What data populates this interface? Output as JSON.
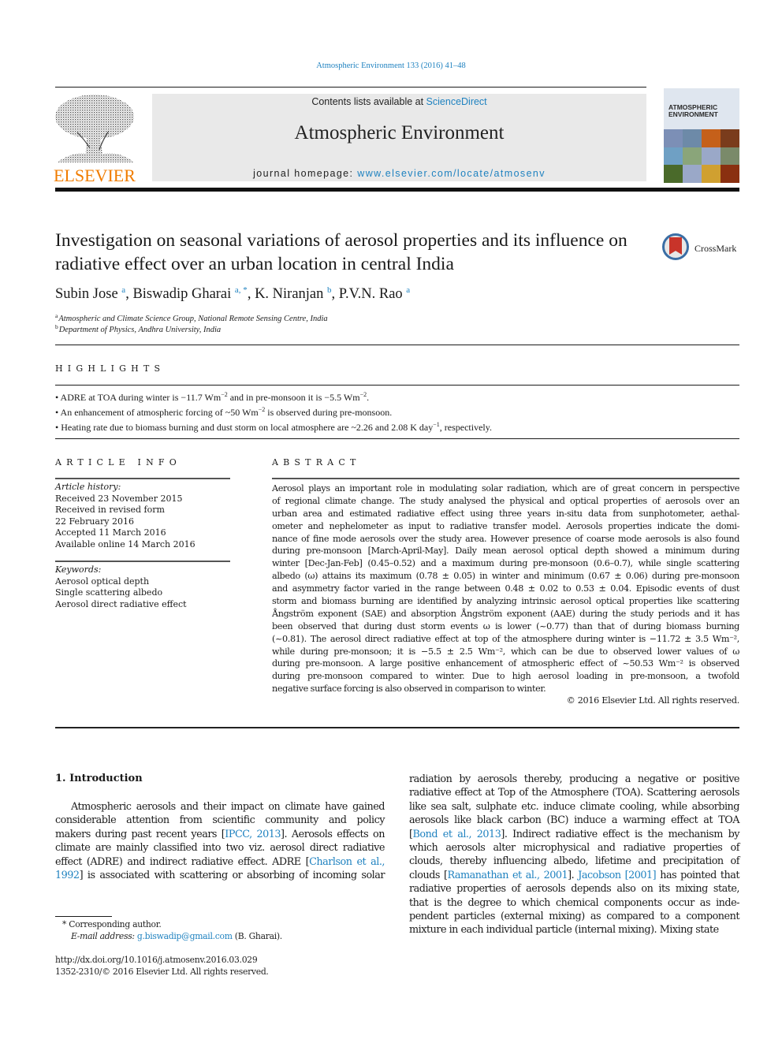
{
  "header": {
    "journal_ref": "Atmospheric Environment 133 (2016) 41–48",
    "contents_prefix": "Contents lists available at ",
    "contents_link": "ScienceDirect",
    "journal_name": "Atmospheric Environment",
    "homepage_prefix": "journal homepage: ",
    "homepage_link": "www.elsevier.com/locate/atmosenv",
    "publisher_logo": "ELSEVIER",
    "cover_title_line1": "ATMOSPHERIC",
    "cover_title_line2": "ENVIRONMENT"
  },
  "colors": {
    "link": "#1f82c0",
    "elsevier_orange": "#f07c00",
    "banner_bg": "#e9e9e9"
  },
  "article": {
    "title": "Investigation on seasonal variations of aerosol properties and its influence on radiative effect over an urban location in central India",
    "crossmark_label": "CrossMark",
    "authors": [
      {
        "name": "Subin Jose",
        "sup": "a",
        "sep": ", "
      },
      {
        "name": "Biswadip Gharai",
        "sup": "a, *",
        "sep": ", "
      },
      {
        "name": "K. Niranjan",
        "sup": "b",
        "sep": ", "
      },
      {
        "name": "P.V.N. Rao",
        "sup": "a",
        "sep": ""
      }
    ],
    "affiliations": [
      {
        "key": "a",
        "text": "Atmospheric and Climate Science Group, National Remote Sensing Centre, India"
      },
      {
        "key": "b",
        "text": "Department of Physics, Andhra University, India"
      }
    ]
  },
  "highlights": {
    "heading": "HIGHLIGHTS",
    "items": [
      {
        "parts": [
          "• ADRE at TOA during winter is −11.7 Wm",
          "−2",
          " and in pre-monsoon it is −5.5 Wm",
          "−2",
          "."
        ]
      },
      {
        "parts": [
          "• An enhancement of atmospheric forcing of ~50 Wm",
          "−2",
          " is observed during pre-monsoon."
        ]
      },
      {
        "parts": [
          "• Heating rate due to biomass burning and dust storm on local atmosphere are ~2.26 and 2.08 K day",
          "−1",
          ", respectively."
        ]
      }
    ]
  },
  "article_info": {
    "heading": "ARTICLE INFO",
    "history_label": "Article history:",
    "history": [
      "Received 23 November 2015",
      "Received in revised form",
      "22 February 2016",
      "Accepted 11 March 2016",
      "Available online 14 March 2016"
    ],
    "keywords_label": "Keywords:",
    "keywords": [
      "Aerosol optical depth",
      "Single scattering albedo",
      "Aerosol direct radiative effect"
    ]
  },
  "abstract": {
    "heading": "ABSTRACT",
    "lines": [
      "Aerosol plays an important role in modulating solar radiation, which are of great concern in perspective",
      "of regional climate change. The study analysed the physical and optical properties of aerosols over an",
      "urban area and estimated radiative effect using three years in-situ data from sunphotometer, aethal-",
      "ometer and nephelometer as input to radiative transfer model. Aerosols properties indicate the domi-",
      "nance of fine mode aerosols over the study area. However presence of coarse mode aerosols is also found",
      "during pre-monsoon [March-April-May]. Daily mean aerosol optical depth showed a minimum during",
      "winter [Dec-Jan-Feb] (0.45–0.52) and a maximum during pre-monsoon (0.6–0.7), while single scattering",
      "albedo (ω) attains its maximum (0.78 ± 0.05) in winter and minimum (0.67 ± 0.06) during pre-monsoon",
      "and asymmetry factor varied in the range between 0.48 ± 0.02 to 0.53 ± 0.04. Episodic events of dust",
      "storm and biomass burning are identified by analyzing intrinsic aerosol optical properties like scattering",
      "Ångström exponent (SAE) and absorption Ångström exponent (AAE) during the study periods and it has",
      "been observed that during dust storm events ω is lower (~0.77) than that of during biomass burning",
      "(~0.81). The aerosol direct radiative effect at top of the atmosphere during winter is −11.72 ± 3.5 Wm⁻²,",
      "while during pre-monsoon; it is −5.5 ± 2.5 Wm⁻², which can be due to observed lower values of ω",
      "during pre-monsoon. A large positive enhancement of atmospheric effect of ~50.53 Wm⁻² is observed",
      "during pre-monsoon compared to winter. Due to high aerosol loading in pre-monsoon, a twofold",
      "negative surface forcing is also observed in comparison to winter."
    ],
    "copyright": "© 2016 Elsevier Ltd. All rights reserved."
  },
  "introduction": {
    "heading": "1.  Introduction",
    "left_lines": [
      {
        "text": "Atmospheric aerosols and their impact on climate have gained",
        "indent": true
      },
      {
        "text": "considerable attention from scientific community and policy"
      },
      {
        "pre": "makers during past recent years [",
        "link": "IPCC, 2013",
        "post": "]. Aerosols effects on"
      },
      {
        "text": "climate are mainly classified into two viz. aerosol direct radiative"
      },
      {
        "pre": "effect (ADRE) and indirect radiative effect. ADRE [",
        "link": "Charlson et al.,",
        "post": ""
      },
      {
        "pre": "",
        "link": "1992",
        "post": "] is associated with scattering or absorbing of incoming solar"
      }
    ],
    "right_lines": [
      {
        "text": "radiation by aerosols thereby, producing a negative or positive"
      },
      {
        "text": "radiative effect at Top of the Atmosphere (TOA). Scattering aerosols"
      },
      {
        "text": "like sea salt, sulphate etc. induce climate cooling, while absorbing"
      },
      {
        "text": "aerosols like black carbon (BC) induce a warming effect at TOA"
      },
      {
        "pre": "[",
        "link": "Bond et al., 2013",
        "post": "]. Indirect radiative effect is the mechanism by"
      },
      {
        "text": "which aerosols alter microphysical and radiative properties of"
      },
      {
        "text": "clouds, thereby influencing albedo, lifetime and precipitation of"
      },
      {
        "pre": "clouds [",
        "link": "Ramanathan et al., 2001",
        "post": "]. ",
        "link2": "Jacobson [2001]",
        "post2": " has pointed that"
      },
      {
        "text": "radiative properties of aerosols depends also on its mixing state,"
      },
      {
        "text": "that is the degree to which chemical components occur as inde-"
      },
      {
        "text": "pendent particles (external mixing) as compared to a component"
      },
      {
        "text": "mixture in each individual particle (internal mixing). Mixing state",
        "last": true
      }
    ]
  },
  "footnotes": {
    "corresponding": "* Corresponding author.",
    "email_label": "E-mail address:",
    "email": "g.biswadip@gmail.com",
    "email_owner": "(B. Gharai).",
    "doi": "http://dx.doi.org/10.1016/j.atmosenv.2016.03.029",
    "issn_copyright": "1352-2310/© 2016 Elsevier Ltd. All rights reserved."
  }
}
